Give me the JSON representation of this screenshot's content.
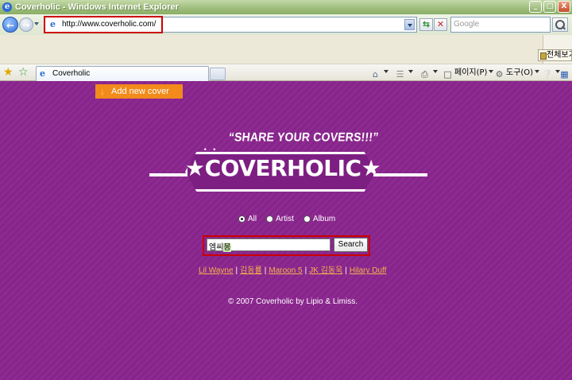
{
  "window": {
    "title": "Coverholic - Windows Internet Explorer",
    "buttons": [
      "_",
      "□",
      "X"
    ]
  },
  "address_bar": {
    "url": "http://www.coverholic.com/",
    "search_placeholder": "Google"
  },
  "overflow": {
    "label": "전체보기"
  },
  "tab_bar": {
    "tab_label": "Coverholic",
    "commands": {
      "page": "페이지(P)",
      "tools": "도구(O)"
    }
  },
  "page": {
    "add_cover_label": "Add new cover",
    "tagline": "“SHARE YOUR COVERS!!!”",
    "logo_text": "★COVERHOLIC★",
    "radio_options": [
      "All",
      "Artist",
      "Album"
    ],
    "selected_radio": "All",
    "search_value_main": "엠씨",
    "search_value_composing": "몽",
    "search_button": "Search",
    "quick_links": [
      "Lil Wayne",
      "김동률",
      "Maroon 5",
      "JK 김동욱",
      "Hilary Duff"
    ],
    "footer": "© 2007 Coverholic by Lipio & Limiss."
  },
  "colors": {
    "page_background": "#8e2a92",
    "accent_orange": "#f28b1c",
    "link_color": "#f7b24a",
    "highlight_red": "#cc0000"
  }
}
